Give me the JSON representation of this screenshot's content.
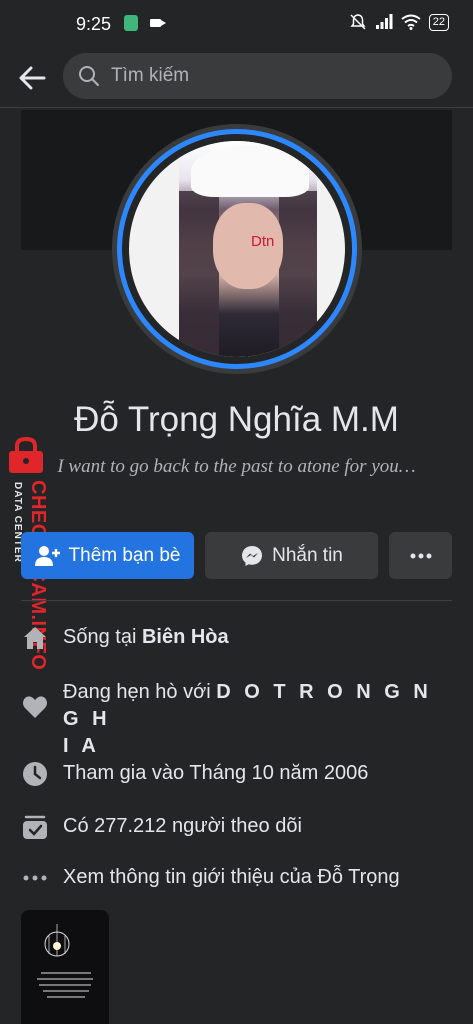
{
  "status_bar": {
    "time": "9:25",
    "battery": "22"
  },
  "search": {
    "placeholder": "Tìm kiếm"
  },
  "profile": {
    "avatar_tag": "Dtn",
    "name": "Đỗ Trọng Nghĩa M.M",
    "bio": "I want to go back to the past to atone for you…"
  },
  "actions": {
    "add_friend": "Thêm bạn bè",
    "message": "Nhắn tin"
  },
  "info": {
    "lives_prefix": "Sống tại ",
    "lives_city": "Biên Hòa",
    "dating_prefix": "Đang hẹn hò với ",
    "dating_name_line1": "D O T R O N G N G H",
    "dating_name_line2": "I A",
    "joined": "Tham gia vào Tháng 10 năm 2006",
    "followers": "Có 277.212 người theo dõi",
    "see_about": "Xem thông tin giới thiệu của Đỗ Trọng"
  },
  "watermark": {
    "main": "CHECKSCAM.INFO",
    "sub": "DATA CENTER"
  },
  "colors": {
    "accent": "#2374e1",
    "ring": "#2d88ff",
    "background": "#242526",
    "button_dark": "#3a3b3c",
    "watermark": "#e0252b"
  },
  "icons": [
    "back-arrow-icon",
    "search-icon",
    "add-person-icon",
    "messenger-icon",
    "more-dots-icon",
    "home-icon",
    "heart-icon",
    "clock-icon",
    "followers-icon",
    "dots-icon"
  ]
}
